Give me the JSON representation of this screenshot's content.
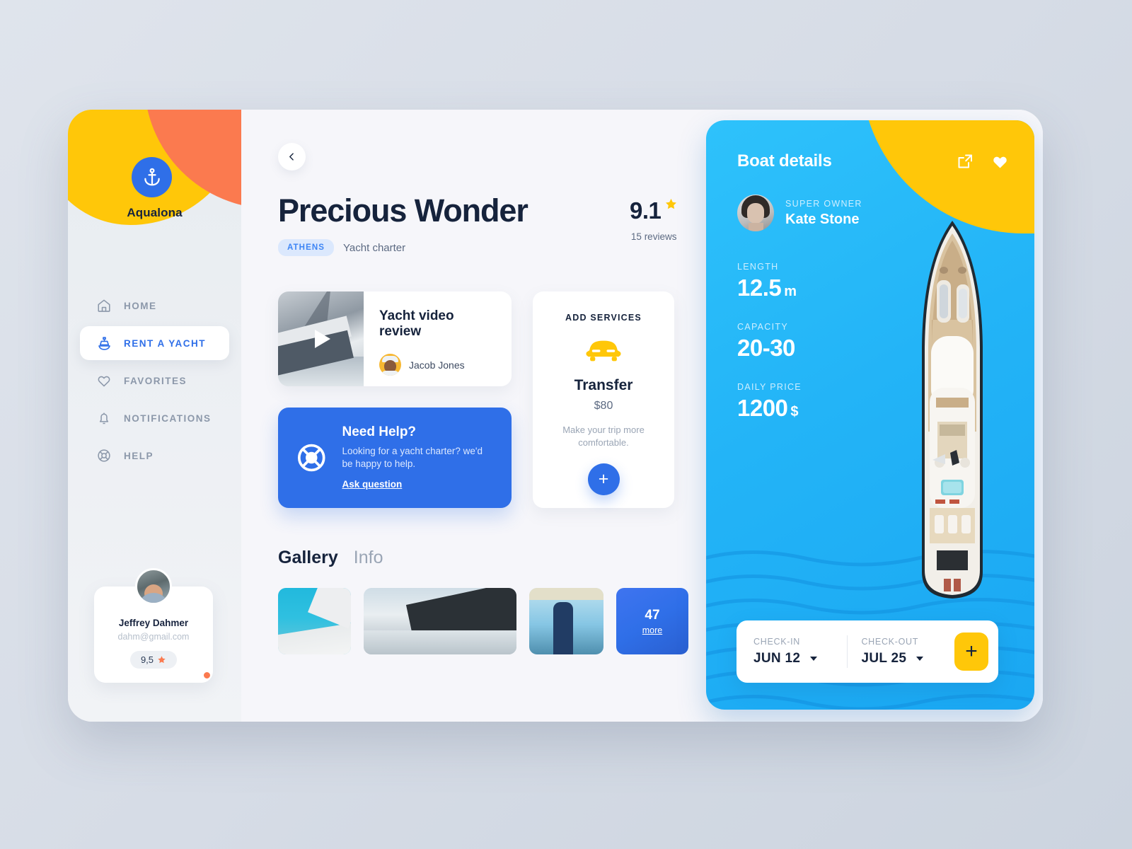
{
  "sidebar": {
    "brand": "Aqualona",
    "logo_icon": "anchor-icon",
    "nav": [
      {
        "label": "HOME",
        "icon": "home-icon",
        "active": false
      },
      {
        "label": "RENT A YACHT",
        "icon": "boat-icon",
        "active": true
      },
      {
        "label": "FAVORITES",
        "icon": "heart-icon",
        "active": false
      },
      {
        "label": "NOTIFICATIONS",
        "icon": "bell-icon",
        "active": false
      },
      {
        "label": "HELP",
        "icon": "lifebuoy-icon",
        "active": false
      }
    ],
    "user": {
      "name": "Jeffrey Dahmer",
      "email": "dahm@gmail.com",
      "rating": "9,5",
      "status_color": "#fb7a4f"
    }
  },
  "main": {
    "back_icon": "chevron-left-icon",
    "title": "Precious Wonder",
    "city": "ATHENS",
    "charter_type": "Yacht charter",
    "rating": "9.1",
    "rating_star_color": "#ffc709",
    "reviews": "15 reviews",
    "video": {
      "title": "Yacht video review",
      "author": "Jacob Jones",
      "play_icon": "play-icon"
    },
    "help": {
      "title": "Need Help?",
      "description": "Looking for a yacht charter? we'd be happy to help.",
      "link": "Ask question",
      "icon": "lifebuoy-icon",
      "bg_color": "#2f6fe8"
    },
    "services": {
      "header": "ADD SERVICES",
      "icon": "car-icon",
      "name": "Transfer",
      "price": "$80",
      "description": "Make your trip more comfortable.",
      "add_label": "+"
    },
    "tabs": [
      {
        "label": "Gallery",
        "active": true
      },
      {
        "label": "Info",
        "active": false
      }
    ],
    "gallery": {
      "more_count": "47",
      "more_label": "more"
    }
  },
  "details": {
    "title": "Boat details",
    "share_icon": "share-icon",
    "favorite_icon": "heart-icon",
    "owner_label": "SUPER OWNER",
    "owner_name": "Kate Stone",
    "specs": [
      {
        "label": "LENGTH",
        "value": "12.5",
        "unit": "m"
      },
      {
        "label": "CAPACITY",
        "value": "20-30",
        "unit": ""
      },
      {
        "label": "DAILY PRICE",
        "value": "1200",
        "unit": "$"
      }
    ],
    "booking": {
      "checkin_label": "CHECK-IN",
      "checkin_value": "JUN 12",
      "checkout_label": "CHECK-OUT",
      "checkout_value": "JUL 25",
      "add_label": "+",
      "add_color": "#ffc709"
    },
    "bg_color": "#23b4f7"
  }
}
